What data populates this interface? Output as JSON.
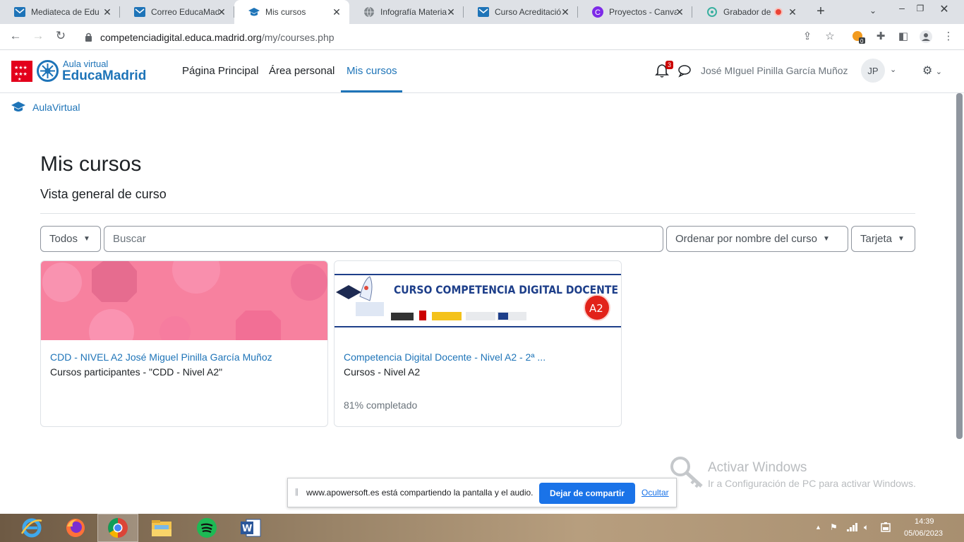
{
  "browser": {
    "tabs": [
      {
        "label": "Mediateca de Edu",
        "icon": "educamadrid-icon",
        "active": false
      },
      {
        "label": "Correo EducaMadr",
        "icon": "mail-icon",
        "active": false
      },
      {
        "label": "Mis cursos",
        "icon": "mortarboard-icon",
        "active": true
      },
      {
        "label": "Infografía Materia",
        "icon": "globe-icon",
        "active": false
      },
      {
        "label": "Curso Acreditació",
        "icon": "educamadrid-icon",
        "active": false
      },
      {
        "label": "Proyectos - Canva",
        "icon": "canva-icon",
        "active": false
      },
      {
        "label": "Grabador de",
        "icon": "apowersoft-icon",
        "active": false
      }
    ],
    "url_host": "competenciadigital.educa.madrid.org",
    "url_path": "/my/courses.php"
  },
  "header": {
    "brand_small": "Aula virtual",
    "brand_big": "EducaMadrid",
    "nav": {
      "home": "Página Principal",
      "personal": "Área personal",
      "courses": "Mis cursos"
    },
    "notification_count": "3",
    "user_name": "José MIguel Pinilla García Muñoz",
    "user_initials": "JP"
  },
  "breadcrumb": "AulaVirtual",
  "main": {
    "title": "Mis cursos",
    "subtitle": "Vista general de curso",
    "filters": {
      "grouping": "Todos",
      "search_placeholder": "Buscar",
      "sort": "Ordenar por nombre del curso",
      "view": "Tarjeta"
    },
    "courses": [
      {
        "name": "CDD - NIVEL A2 José Miguel Pinilla García Muñoz",
        "category": "Cursos participantes - \"CDD - Nivel A2\"",
        "progress": ""
      },
      {
        "name": "Competencia Digital Docente - Nivel A2 - 2ª ...",
        "category": "Cursos - Nivel A2",
        "progress": "81% completado",
        "banner_title": "CURSO COMPETENCIA DIGITAL DOCENTE",
        "banner_badge": "A2"
      }
    ]
  },
  "watermark": {
    "title": "Activar Windows",
    "subtitle": "Ir a Configuración de PC para activar Windows."
  },
  "share_bar": {
    "text": "www.apowersoft.es está compartiendo la pantalla y el audio.",
    "stop_button": "Dejar de compartir",
    "hide_link": "Ocultar"
  },
  "taskbar": {
    "time": "14:39",
    "date": "05/06/2023"
  },
  "colors": {
    "accent": "#1e74b8",
    "brand_red": "#e3001b",
    "share_blue": "#1a73e8",
    "card_pink": "#f7819f"
  }
}
